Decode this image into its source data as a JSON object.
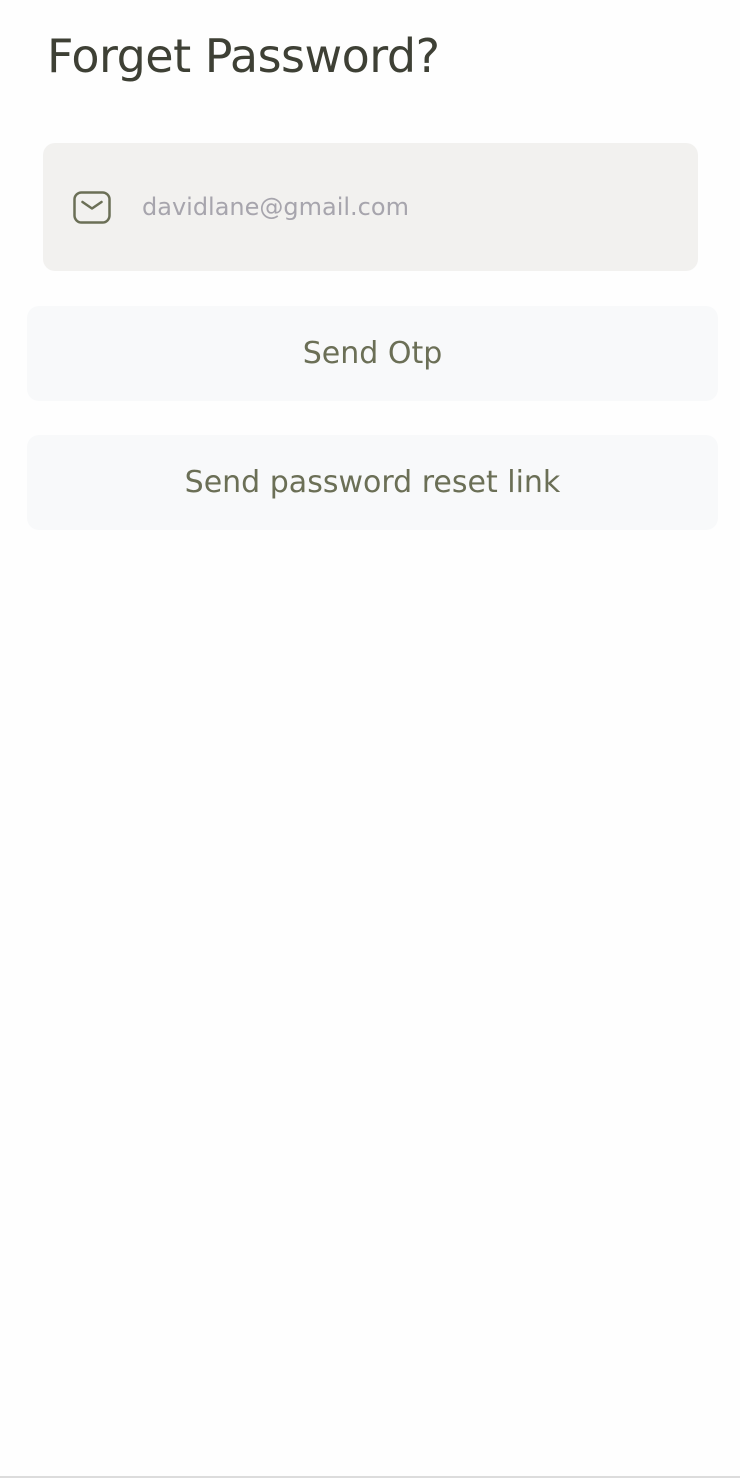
{
  "page": {
    "title": "Forget Password?"
  },
  "email": {
    "value": "davidlane@gmail.com",
    "icon": "mail-icon"
  },
  "actions": {
    "send_otp_label": "Send Otp",
    "send_reset_link_label": "Send password reset link"
  },
  "colors": {
    "title": "#3e4035",
    "field_background": "#f2f1ef",
    "button_background": "#f8f9fa",
    "button_text": "#6b6f56",
    "icon": "#6b6f56",
    "input_text": "#a7a5ad"
  }
}
